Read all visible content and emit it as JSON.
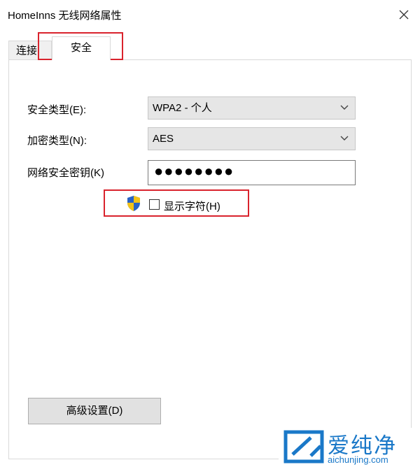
{
  "window": {
    "title": "HomeInns 无线网络属性"
  },
  "tabs": [
    {
      "label": "连接"
    },
    {
      "label": "安全"
    }
  ],
  "form": {
    "security_type_label": "安全类型(E):",
    "security_type_value": "WPA2 - 个人",
    "encryption_type_label": "加密类型(N):",
    "encryption_type_value": "AES",
    "key_label": "网络安全密钥(K)",
    "key_value": "●●●●●●●●",
    "show_chars_label": "显示字符(H)",
    "show_chars_checked": false
  },
  "buttons": {
    "advanced": "高级设置(D)"
  },
  "watermark": {
    "text": "爱纯净",
    "url": "aichunjing.com"
  },
  "colors": {
    "highlight": "#d9232d",
    "watermark": "#1a78c8",
    "shield_blue": "#2a63c4",
    "shield_yellow": "#f3c317"
  }
}
